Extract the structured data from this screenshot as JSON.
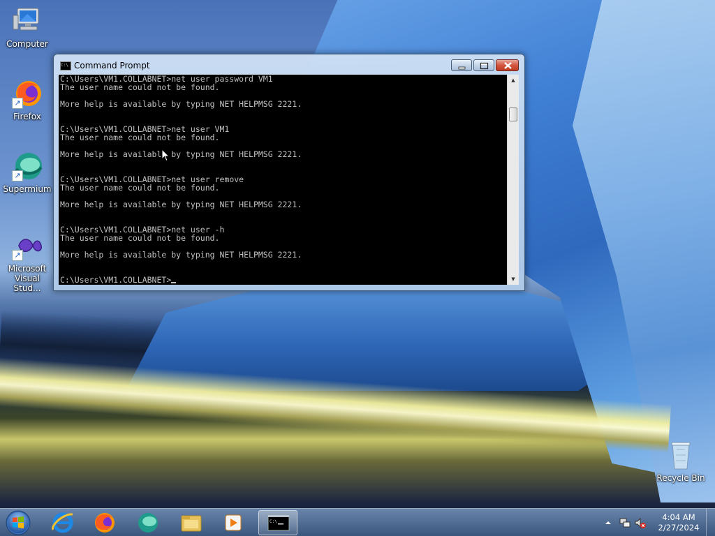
{
  "desktop": {
    "icons": [
      {
        "label": "Computer",
        "icon": "computer-icon"
      },
      {
        "label": "Firefox",
        "icon": "firefox-icon"
      },
      {
        "label": "Supermium",
        "icon": "supermium-icon"
      },
      {
        "label": "Microsoft Visual Stud...",
        "icon": "visual-studio-icon"
      },
      {
        "label": "Recycle Bin",
        "icon": "recycle-bin-icon"
      }
    ]
  },
  "cmd_window": {
    "title": "Command Prompt",
    "lines": [
      "C:\\Users\\VM1.COLLABNET>net user password VM1",
      "The user name could not be found.",
      "",
      "More help is available by typing NET HELPMSG 2221.",
      "",
      "",
      "C:\\Users\\VM1.COLLABNET>net user VM1",
      "The user name could not be found.",
      "",
      "More help is available by typing NET HELPMSG 2221.",
      "",
      "",
      "C:\\Users\\VM1.COLLABNET>net user remove",
      "The user name could not be found.",
      "",
      "More help is available by typing NET HELPMSG 2221.",
      "",
      "",
      "C:\\Users\\VM1.COLLABNET>net user -h",
      "The user name could not be found.",
      "",
      "More help is available by typing NET HELPMSG 2221.",
      "",
      ""
    ],
    "prompt": "C:\\Users\\VM1.COLLABNET>",
    "buttons": {
      "minimize": "minimize-icon",
      "maximize": "maximize-icon",
      "close": "close-icon"
    }
  },
  "taskbar": {
    "pinned": [
      {
        "name": "internet-explorer",
        "icon": "internet-explorer-icon"
      },
      {
        "name": "firefox",
        "icon": "firefox-icon"
      },
      {
        "name": "supermium",
        "icon": "supermium-icon"
      },
      {
        "name": "file-explorer",
        "icon": "folder-icon"
      },
      {
        "name": "media-player",
        "icon": "media-player-icon"
      },
      {
        "name": "command-prompt",
        "icon": "cmd-icon",
        "active": true
      }
    ],
    "clock": {
      "time": "4:04 AM",
      "date": "2/27/2024"
    },
    "tray_icons": [
      "show-hidden-icons-icon",
      "network-icon",
      "volume-muted-icon"
    ]
  },
  "colors": {
    "console_bg": "#000000",
    "console_text": "#c0c0c0",
    "taskbar": "#4a6c98",
    "close_button": "#c8432b"
  }
}
